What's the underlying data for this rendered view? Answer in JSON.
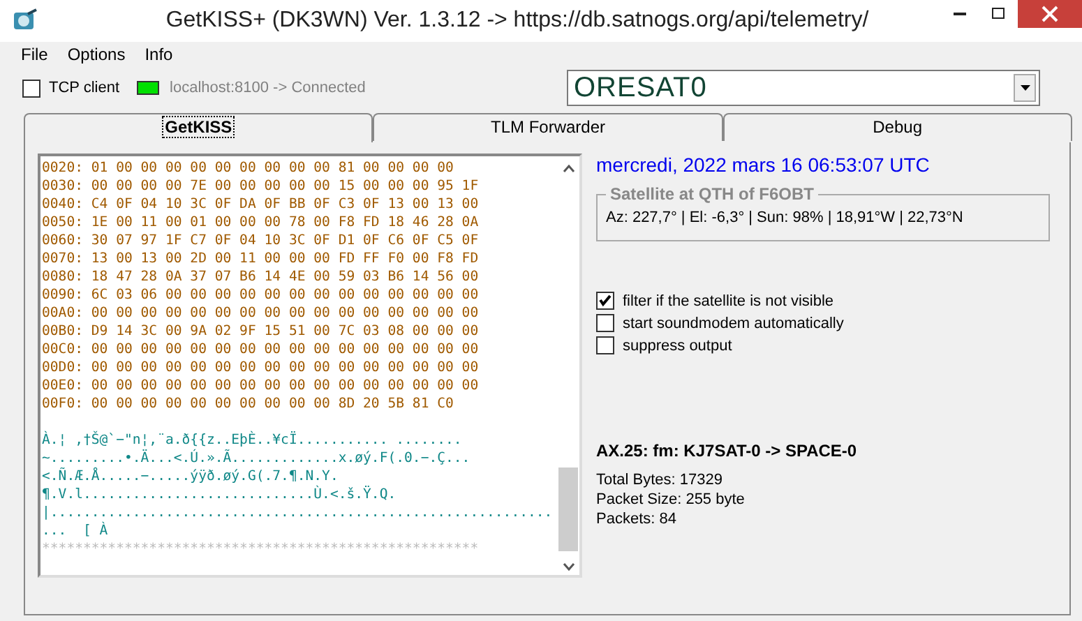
{
  "window": {
    "title": "GetKISS+ (DK3WN) Ver. 1.3.12 -> https://db.satnogs.org/api/telemetry/"
  },
  "menu": [
    "File",
    "Options",
    "Info"
  ],
  "toolbar": {
    "tcp_client": {
      "label": "TCP client",
      "checked": false
    },
    "connection": {
      "status": "localhost:8100 -> Connected",
      "color": "#00e000"
    },
    "satellite": {
      "value": "ORESAT0"
    }
  },
  "tabs": [
    {
      "label": "GetKISS",
      "selected": true
    },
    {
      "label": "TLM Forwarder",
      "selected": false
    },
    {
      "label": "Debug",
      "selected": false
    }
  ],
  "hex_dump": [
    "0020: 01 00 00 00 00 00 00 00 00 00 81 00 00 00 00",
    "0030: 00 00 00 00 7E 00 00 00 00 00 15 00 00 00 95 1F",
    "0040: C4 0F 04 10 3C 0F DA 0F BB 0F C3 0F 13 00 13 00",
    "0050: 1E 00 11 00 01 00 00 00 78 00 F8 FD 18 46 28 0A",
    "0060: 30 07 97 1F C7 0F 04 10 3C 0F D1 0F C6 0F C5 0F",
    "0070: 13 00 13 00 2D 00 11 00 00 00 FD FF F0 00 F8 FD",
    "0080: 18 47 28 0A 37 07 B6 14 4E 00 59 03 B6 14 56 00",
    "0090: 6C 03 06 00 00 00 00 00 00 00 00 00 00 00 00 00",
    "00A0: 00 00 00 00 00 00 00 00 00 00 00 00 00 00 00 00",
    "00B0: D9 14 3C 00 9A 02 9F 15 51 00 7C 03 08 00 00 00",
    "00C0: 00 00 00 00 00 00 00 00 00 00 00 00 00 00 00 00",
    "00D0: 00 00 00 00 00 00 00 00 00 00 00 00 00 00 00 00",
    "00E0: 00 00 00 00 00 00 00 00 00 00 00 00 00 00 00 00",
    "00F0: 00 00 00 00 00 00 00 00 00 00 8D 20 5B 81 C0"
  ],
  "ascii_dump": [
    "À.¦ ,†Š@`−\"n¦,¨a.ð{{z..EþÈ..¥cÏ........... ........",
    "~.........•.Ä...<.Ú.».Ã.............x.øý.F(.0.−.Ç...",
    "<.Ñ.Æ.Å.....−.....ýÿð.øý.G(.7.¶.N.Y.",
    "¶.V.l............................Ù.<.š.Ÿ.Q.",
    "|.............................................................",
    "...  [ À"
  ],
  "separator": "*****************************************************",
  "clock": "mercredi, 2022 mars 16  06:53:07 UTC",
  "satellite_group": {
    "title": "Satellite at QTH of F6OBT",
    "position": "Az: 227,7° | El: -6,3° | Sun: 98% | 18,91°W | 22,73°N"
  },
  "options": [
    {
      "label": "filter if the satellite is not visible",
      "checked": true
    },
    {
      "label": "start soundmodem automatically",
      "checked": false
    },
    {
      "label": "suppress output",
      "checked": false
    }
  ],
  "frame": {
    "header": "AX.25: fm: KJ7SAT-0 -> SPACE-0",
    "stats": [
      "Total Bytes: 17329",
      "Packet Size: 255 byte",
      "Packets: 84"
    ]
  }
}
